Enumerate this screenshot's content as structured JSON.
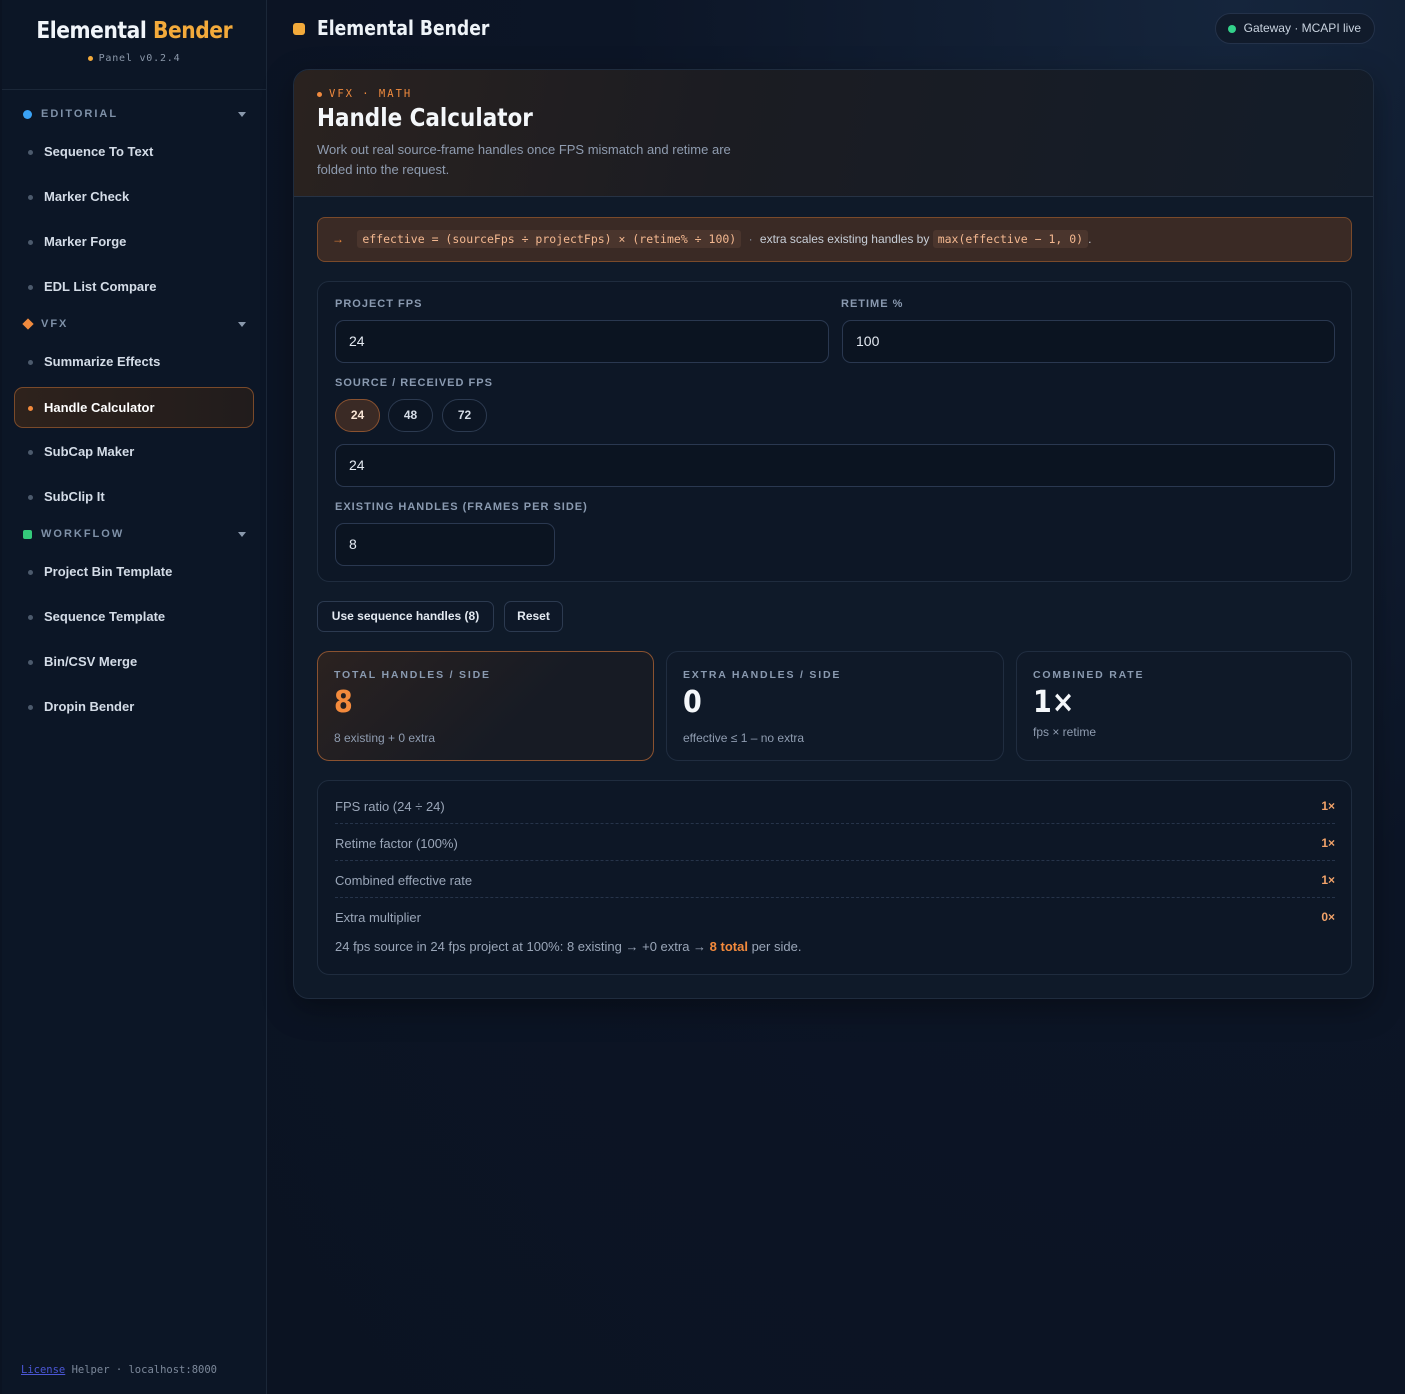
{
  "brand": {
    "title_main": "Elemental ",
    "title_accent": "Bender",
    "version": "Panel v0.2.4"
  },
  "sidebar": {
    "sections": [
      {
        "label": "EDITORIAL",
        "items": [
          "Sequence To Text",
          "Marker Check",
          "Marker Forge",
          "EDL List Compare"
        ]
      },
      {
        "label": "VFX",
        "items": [
          "Summarize Effects",
          "Handle Calculator",
          "SubCap Maker",
          "SubClip It"
        ]
      },
      {
        "label": "WORKFLOW",
        "items": [
          "Project Bin Template",
          "Sequence Template",
          "Bin/CSV Merge",
          "Dropin Bender"
        ]
      }
    ],
    "active_item": "Handle Calculator",
    "footer": {
      "link": "License",
      "text": " Helper · localhost:8000"
    }
  },
  "topbar": {
    "title": "Elemental Bender",
    "status": "Gateway · MCAPI live"
  },
  "hero": {
    "eyebrow": "VFX · MATH",
    "title": "Handle Calculator",
    "description": "Work out real source-frame handles once FPS mismatch and retime are folded into the request."
  },
  "formula": {
    "arrow": "→",
    "code": "effective = (sourceFps ÷ projectFps) × (retime% ÷ 100)",
    "sep": "·",
    "text": "extra scales existing handles by",
    "code2": "max(effective − 1, 0)",
    "end": "."
  },
  "form": {
    "project_fps_label": "PROJECT FPS",
    "project_fps_value": "24",
    "retime_label": "RETIME %",
    "retime_value": "100",
    "source_fps_label": "SOURCE / RECEIVED FPS",
    "source_fps_presets": [
      "24",
      "48",
      "72"
    ],
    "source_fps_value": "24",
    "handles_label": "EXISTING HANDLES (FRAMES PER SIDE)",
    "handles_value": "8"
  },
  "actions": {
    "use_sequence": "Use sequence handles (8)",
    "reset": "Reset"
  },
  "stats": [
    {
      "label": "TOTAL HANDLES / SIDE",
      "value": "8",
      "sub": "8 existing + 0 extra"
    },
    {
      "label": "EXTRA HANDLES / SIDE",
      "value": "0",
      "sub": "effective ≤ 1 – no extra"
    },
    {
      "label": "COMBINED RATE",
      "value": "1×",
      "sub": "fps × retime"
    }
  ],
  "breakdown": {
    "rows": [
      {
        "label": "FPS ratio (24 ÷ 24)",
        "value": "1×"
      },
      {
        "label": "Retime factor (100%)",
        "value": "1×"
      },
      {
        "label": "Combined effective rate",
        "value": "1×"
      },
      {
        "label": "Extra multiplier",
        "value": "0×"
      }
    ],
    "summary_pre": "24 fps source in 24 fps project at 100%: 8 existing → +0 extra → ",
    "summary_total": "8 total",
    "summary_post": " per side."
  },
  "colors": {
    "accent": "#f38a3c",
    "brand_accent": "#f3aa3b",
    "status_live": "#33d28b",
    "editorial": "#3aa2f5",
    "workflow": "#34c97a"
  }
}
